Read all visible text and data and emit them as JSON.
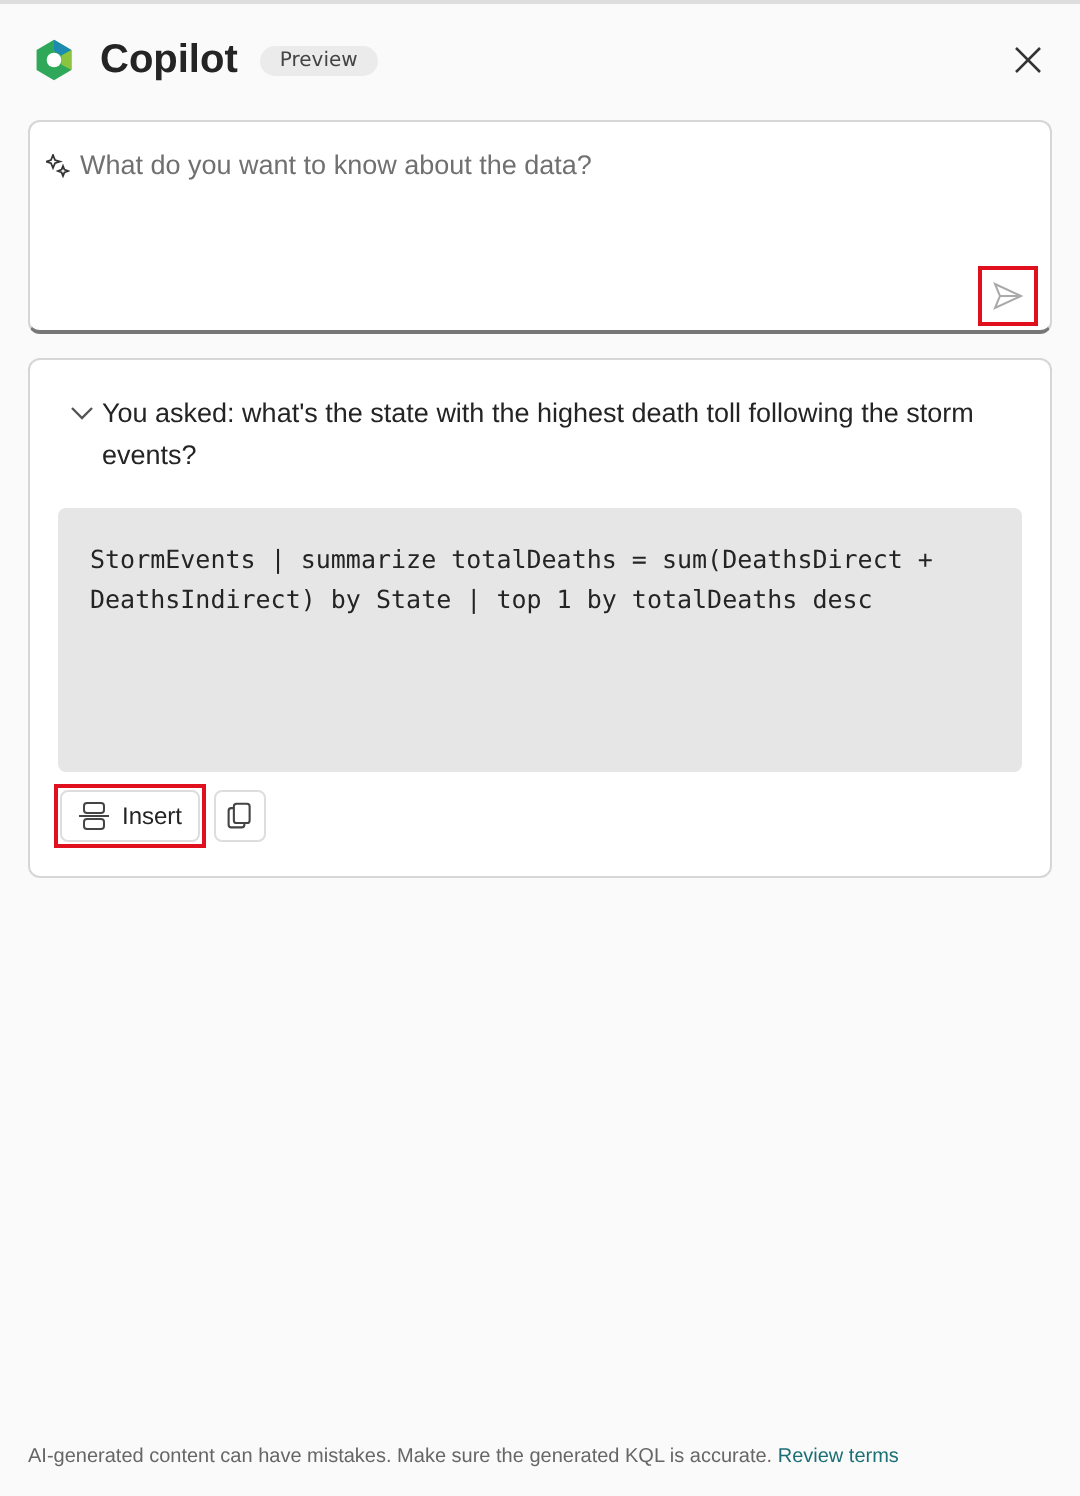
{
  "header": {
    "title": "Copilot",
    "badge": "Preview"
  },
  "prompt": {
    "placeholder": "What do you want to know about the data?",
    "send_highlighted": true
  },
  "answer": {
    "expanded": true,
    "question": "You asked: what's the state with the highest death toll following the storm events?",
    "code": "StormEvents | summarize totalDeaths = sum(DeathsDirect + DeathsIndirect) by State | top 1 by totalDeaths desc",
    "insert_label": "Insert",
    "insert_highlighted": true
  },
  "footer": {
    "disclaimer": "AI-generated content can have mistakes. Make sure the generated KQL is accurate.",
    "link": "Review terms"
  }
}
